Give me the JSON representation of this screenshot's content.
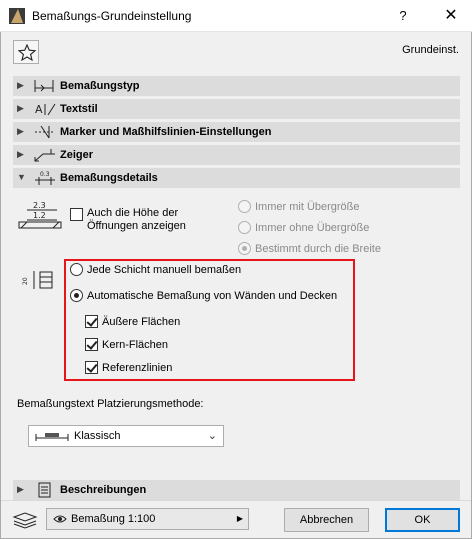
{
  "window": {
    "title": "Bemaßungs-Grundeinstellung",
    "help": "?",
    "close": "✕"
  },
  "preset": {
    "label": "Grundeinst."
  },
  "sections": {
    "s1": "Bemaßungstyp",
    "s2": "Textstil",
    "s3": "Marker und Maßhilfslinien-Einstellungen",
    "s4": "Zeiger",
    "s5": "Bemaßungsdetails",
    "s6": "Beschreibungen"
  },
  "details": {
    "opening_height_label": "Auch die Höhe der Öffnungen anzeigen",
    "opening_height_checked": false,
    "oversize_options": [
      {
        "label": "Immer mit Übergröße",
        "selected": false
      },
      {
        "label": "Immer ohne Übergröße",
        "selected": false
      },
      {
        "label": "Bestimmt durch die Breite",
        "selected": true
      }
    ],
    "layer_options": [
      {
        "label": "Jede Schicht manuell bemaßen",
        "selected": false
      },
      {
        "label": "Automatische Bemaßung von Wänden und Decken",
        "selected": true
      }
    ],
    "auto_checks": [
      {
        "label": "Äußere Flächen",
        "checked": true
      },
      {
        "label": "Kern-Flächen",
        "checked": true
      },
      {
        "label": "Referenzlinien",
        "checked": true
      }
    ],
    "placement_label": "Bemaßungstext Platzierungsmethode:",
    "placement_value": "Klassisch"
  },
  "footer": {
    "layer": "Bemaßung 1:100",
    "cancel": "Abbrechen",
    "ok": "OK"
  }
}
